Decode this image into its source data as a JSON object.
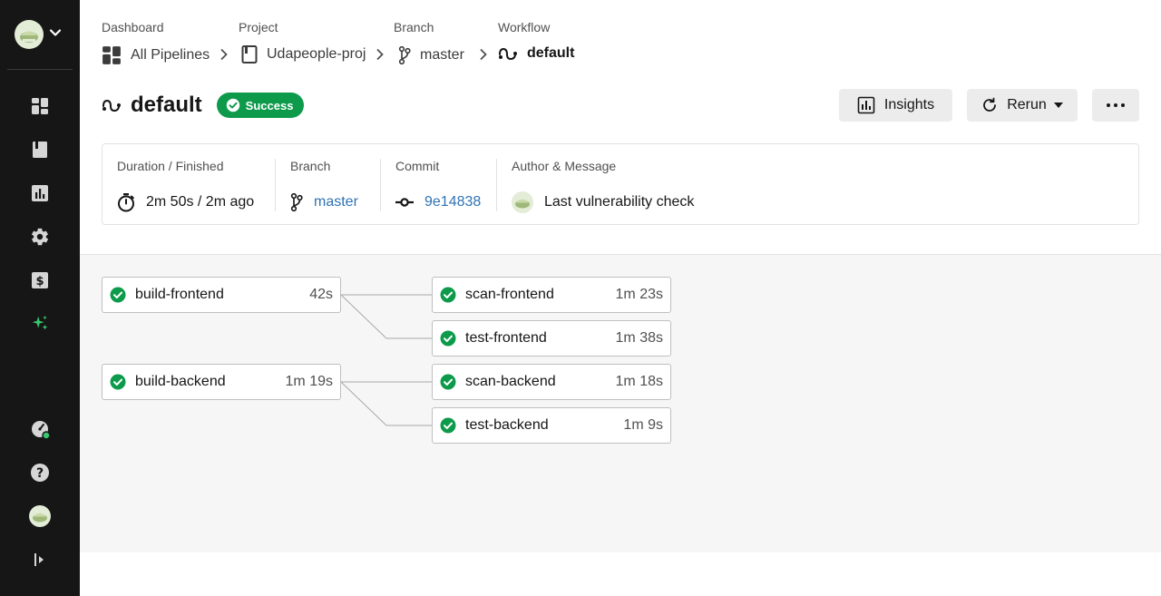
{
  "breadcrumbs": [
    {
      "label": "Dashboard",
      "value": "All Pipelines",
      "icon": "dashboard-grid-icon"
    },
    {
      "label": "Project",
      "value": "Udapeople-proj",
      "icon": "project-book-icon"
    },
    {
      "label": "Branch",
      "value": "master",
      "icon": "branch-icon"
    },
    {
      "label": "Workflow",
      "value": "default",
      "icon": "workflow-icon"
    }
  ],
  "workflow": {
    "title": "default",
    "status": "Success",
    "status_color": "#0d9a4b"
  },
  "actions": {
    "insights": "Insights",
    "rerun": "Rerun",
    "more": "more-options-icon"
  },
  "info": {
    "duration_label": "Duration / Finished",
    "duration_value": "2m 50s / 2m ago",
    "branch_label": "Branch",
    "branch_value": "master",
    "commit_label": "Commit",
    "commit_value": "9e14838",
    "author_label": "Author & Message",
    "author_message": "Last vulnerability check"
  },
  "jobs": [
    {
      "name": "build-frontend",
      "duration": "42s",
      "status": "success"
    },
    {
      "name": "scan-frontend",
      "duration": "1m 23s",
      "status": "success"
    },
    {
      "name": "test-frontend",
      "duration": "1m 38s",
      "status": "success"
    },
    {
      "name": "build-backend",
      "duration": "1m 19s",
      "status": "success"
    },
    {
      "name": "scan-backend",
      "duration": "1m 18s",
      "status": "success"
    },
    {
      "name": "test-backend",
      "duration": "1m 9s",
      "status": "success"
    }
  ],
  "sidebar": {
    "items": [
      {
        "name": "dashboard-icon"
      },
      {
        "name": "projects-icon"
      },
      {
        "name": "insights-icon"
      },
      {
        "name": "settings-icon"
      },
      {
        "name": "plan-billing-icon"
      },
      {
        "name": "whats-new-icon"
      }
    ],
    "bottom": [
      {
        "name": "status-gauge-icon"
      },
      {
        "name": "help-icon"
      },
      {
        "name": "user-avatar"
      },
      {
        "name": "collapse-sidebar-icon"
      }
    ],
    "accent": "#39c66f"
  }
}
